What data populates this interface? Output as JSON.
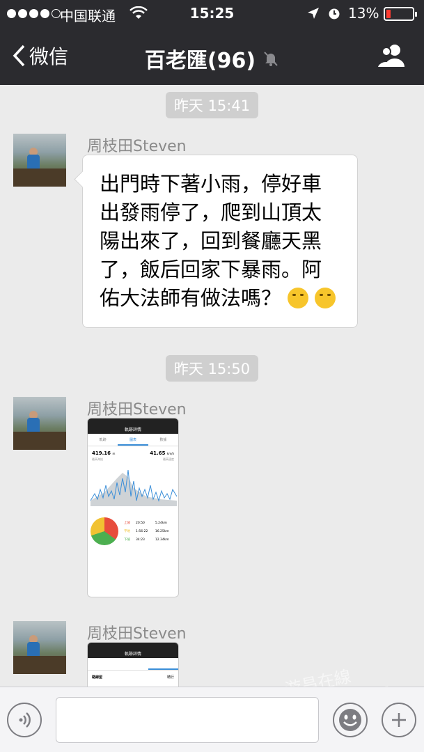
{
  "status": {
    "carrier": "中国联通",
    "time": "15:25",
    "battery": "13%",
    "battery_level": 0.13,
    "signal_bars": 4,
    "signal_max": 5
  },
  "nav": {
    "back_label": "微信",
    "title": "百老匯(96)"
  },
  "messages": [
    {
      "timestamp": "昨天 15:41",
      "sender": "周枝田Steven",
      "text": "出門時下著小雨，停好車出發雨停了，爬到山頂太陽出來了，回到餐廳天黑了，飯后回家下暴雨。阿佑大法師有做法嗎？"
    },
    {
      "timestamp": "昨天 15:50",
      "sender": "周枝田Steven",
      "image": {
        "header": "軌跡詳情",
        "tabs": [
          "軌跡",
          "圖表",
          "數據"
        ],
        "stat1": "419.16",
        "stat1_unit": "m",
        "stat1_label": "最高海拔",
        "stat2": "41.65",
        "stat2_unit": "km/h",
        "stat2_label": "最高速度",
        "rows": [
          {
            "label": "上坡",
            "time": "20:50",
            "dist": "5.24km"
          },
          {
            "label": "平地",
            "time": "1:56:22",
            "dist": "16.25km"
          },
          {
            "label": "下坡",
            "time": "34:23",
            "dist": "12.34km"
          }
        ]
      }
    },
    {
      "sender": "周枝田Steven",
      "image": {
        "header": "軌跡詳情",
        "row_label": "路線型",
        "row_value": "騎行"
      }
    }
  ],
  "watermark": "游昌在線 luchang.org",
  "colors": {
    "nav_bg": "#2b2b2f",
    "chat_bg": "#ebebeb",
    "battery_low": "#ff3b30"
  },
  "icons": [
    "wifi-icon",
    "location-icon",
    "alarm-icon",
    "back-chevron-icon",
    "mute-bell-icon",
    "group-people-icon",
    "voice-icon",
    "emoji-icon",
    "plus-icon"
  ]
}
